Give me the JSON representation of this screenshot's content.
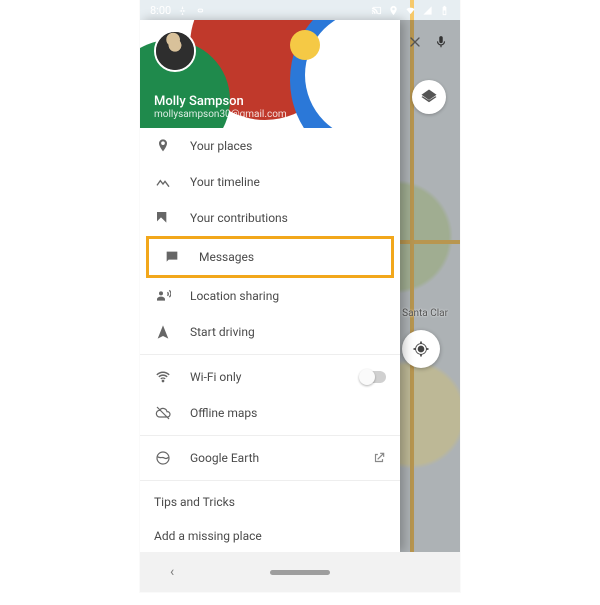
{
  "statusbar": {
    "time": "8:00"
  },
  "search": {
    "close_icon": "close",
    "mic_icon": "mic"
  },
  "map": {
    "label": "Santa Clar",
    "layers_icon": "layers",
    "locate_icon": "my-location"
  },
  "account": {
    "name": "Molly Sampson",
    "email": "mollysampson30@gmail.com"
  },
  "menu": {
    "your_places": "Your places",
    "your_timeline": "Your timeline",
    "your_contributions": "Your contributions",
    "messages": "Messages",
    "location_sharing": "Location sharing",
    "start_driving": "Start driving",
    "wifi_only": "Wi-Fi only",
    "offline_maps": "Offline maps",
    "google_earth": "Google Earth",
    "tips": "Tips and Tricks",
    "add_missing": "Add a missing place"
  }
}
